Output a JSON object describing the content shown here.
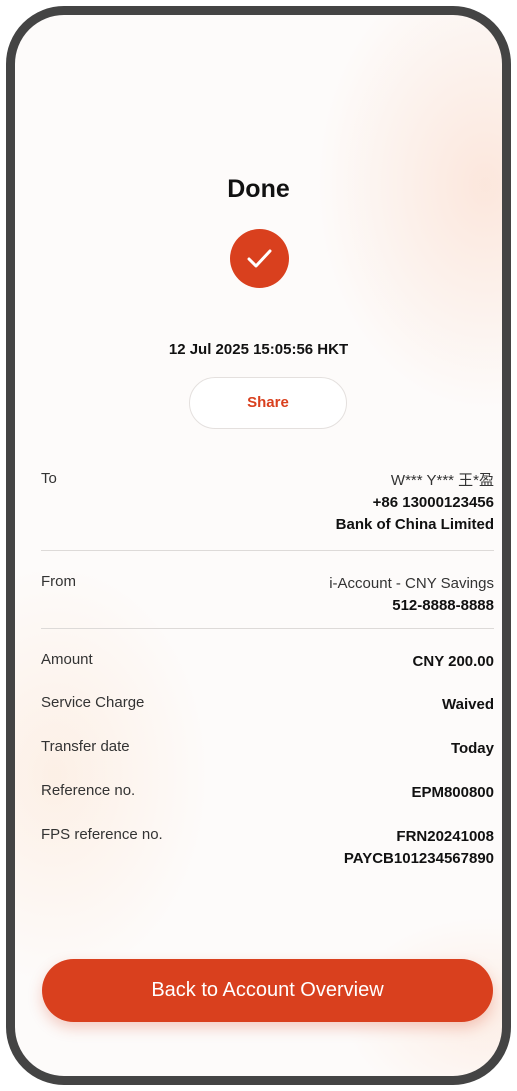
{
  "header": {
    "title": "Done",
    "timestamp": "12 Jul 2025 15:05:56 HKT"
  },
  "status": {
    "icon": "check-icon",
    "accent_color": "#d9401e"
  },
  "actions": {
    "share_label": "Share",
    "back_label": "Back to Account Overview"
  },
  "details": {
    "to": {
      "label": "To",
      "name": "W*** Y*** 王*盈",
      "phone": "+86 13000123456",
      "bank": "Bank of China Limited"
    },
    "from": {
      "label": "From",
      "account_name": "i-Account - CNY Savings",
      "account_number": "512-8888-8888"
    },
    "amount": {
      "label": "Amount",
      "value": "CNY 200.00"
    },
    "service_charge": {
      "label": "Service Charge",
      "value": "Waived"
    },
    "transfer_date": {
      "label": "Transfer date",
      "value": "Today"
    },
    "reference": {
      "label": "Reference no.",
      "value": "EPM800800"
    },
    "fps_reference": {
      "label": "FPS reference no.",
      "line1": "FRN20241008",
      "line2": "PAYCB101234567890"
    }
  }
}
